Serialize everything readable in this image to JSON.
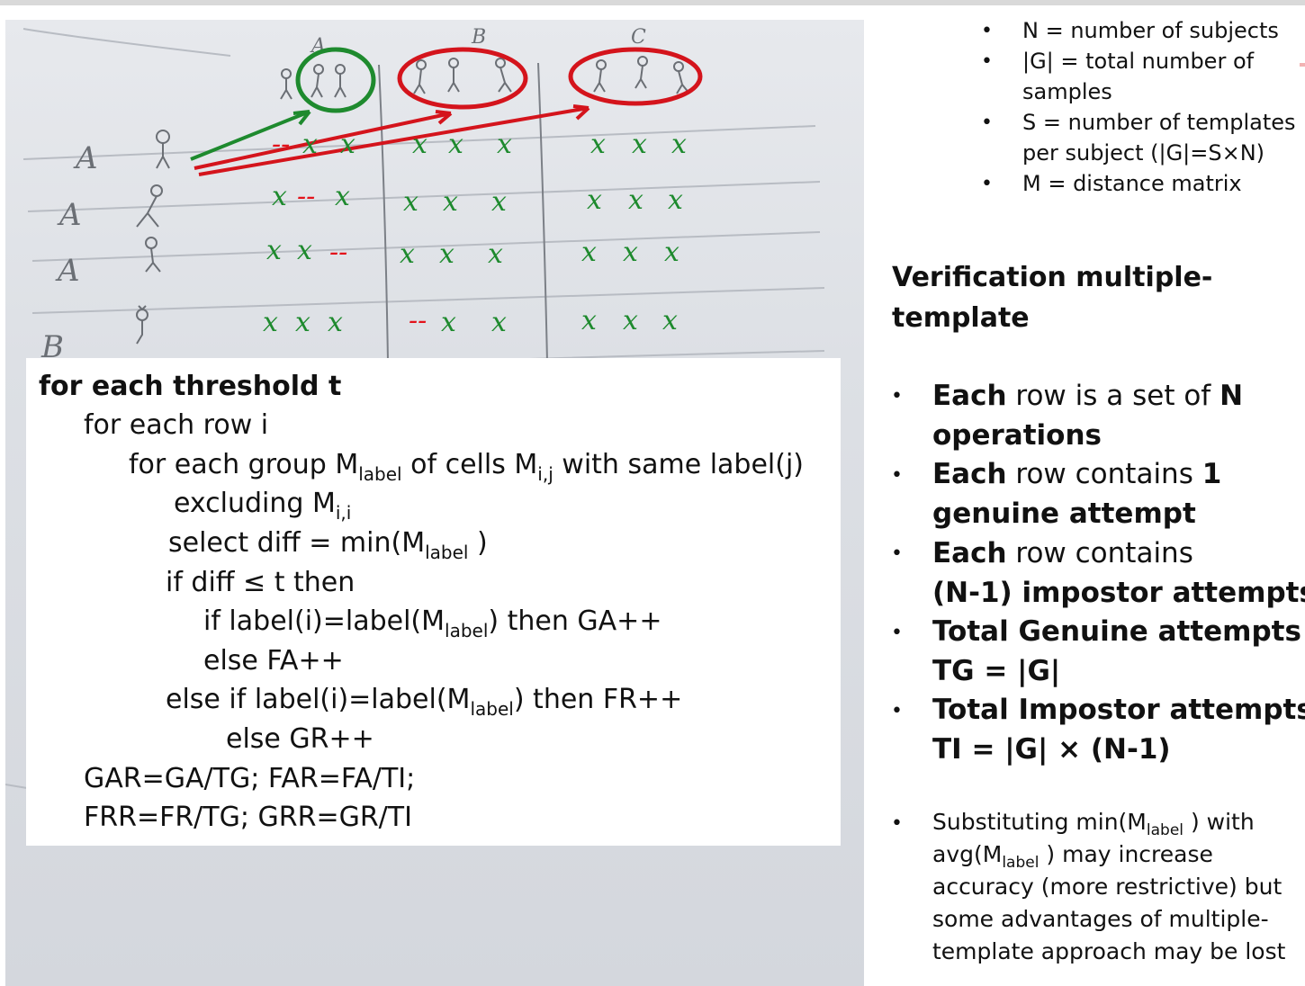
{
  "photo": {
    "row_labels": [
      "A",
      "A",
      "A",
      "B"
    ],
    "column_labels": [
      "A",
      "B",
      "C"
    ],
    "genuine_marker": "--",
    "impostor_marker": "x",
    "colors": {
      "genuine_circle": "#1e8a2e",
      "impostor_circle": "#d4141c",
      "marks": "#1e8a2e",
      "dash": "#e3121a",
      "ink": "#6b6f75"
    }
  },
  "algorithm": {
    "lines": [
      "for each threshold t",
      "for each row i",
      "for each group M",
      "excluding M",
      "select  diff = min(M",
      "if diff ≤ t then",
      "if label(i)=label(M",
      "else FA++",
      "else if label(i)=label(M",
      "else GR++",
      "GAR=GA/TG; FAR=FA/TI;",
      "FRR=FR/TG; GRR=GR/TI"
    ],
    "sub_label": "label",
    "sub_ij": "i,j",
    "sub_ii": "i,i",
    "group_mid": " of cells M",
    "group_tail": " with same label(j)",
    "select_tail": " )",
    "ga_tail": ") then GA++",
    "fr_tail": ") then FR++"
  },
  "definitions": [
    "N = number of subjects",
    "|G| = total number of",
    "samples",
    "S = number of templates",
    "per subject  (|G|=S×N)",
    "M = distance matrix"
  ],
  "title": [
    "Verification multiple-",
    "template"
  ],
  "bullets": {
    "b1_a": "Each",
    "b1_b": " row is a set of ",
    "b1_c": "N",
    "b1_d": "operations",
    "b2_a": "Each",
    "b2_b": " row contains ",
    "b2_c": "1",
    "b2_d": "genuine attempt",
    "b3_a": "Each",
    "b3_b": " row contains",
    "b3_c": "(N-1)  impostor attempts",
    "b4_a": "Total Genuine attempts",
    "b4_b": "TG = |G|",
    "b5_a": "Total Impostor attempts",
    "b5_b": "TI = |G| × (N-1)"
  },
  "note": {
    "l1_a": "Substituting min(M",
    "l1_b": "label",
    "l1_c": " ) with",
    "l2_a": "avg(M",
    "l2_b": "label",
    "l2_c": " ) may increase",
    "l3": "accuracy (more restrictive) but",
    "l4": "some advantages of multiple-",
    "l5": "template approach may be lost"
  },
  "bullet_glyph": "•"
}
